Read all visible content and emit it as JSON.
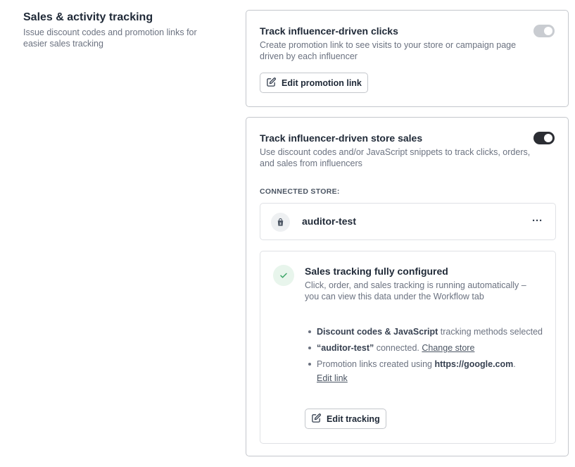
{
  "intro": {
    "title": "Sales & activity tracking",
    "description": "Issue discount codes and promotion links for easier sales tracking"
  },
  "clicks_card": {
    "title": "Track influencer-driven clicks",
    "description": "Create promotion link to see visits to your store or campaign page driven by each influencer",
    "toggle_state": "on-disabled",
    "button_label": "Edit promotion link",
    "button_icon": "edit-icon"
  },
  "sales_card": {
    "title": "Track influencer-driven store sales",
    "description": "Use discount codes and/or JavaScript snippets to track clicks, orders, and sales from influencers",
    "toggle_state": "on",
    "connected_label": "CONNECTED STORE:",
    "store": {
      "icon": "shopify-bag-icon",
      "name": "auditor-test",
      "more_label": "···"
    },
    "status": {
      "icon": "check-icon",
      "title": "Sales tracking fully configured",
      "description": "Click, order, and sales tracking is running automatically – you can view this data under the Workflow tab",
      "bullet1_bold": "Discount codes & JavaScript",
      "bullet1_rest": " tracking methods selected",
      "bullet2_bold": "“auditor-test”",
      "bullet2_rest": " connected. ",
      "bullet2_link": "Change store",
      "bullet3_text": "Promotion links created using ",
      "bullet3_bold": "https://google.com",
      "bullet3_after": ".",
      "bullet3_link": "Edit link",
      "button_label": "Edit tracking",
      "button_icon": "edit-icon"
    }
  },
  "colors": {
    "toggle_on": "#2b2d33",
    "toggle_disabled": "#c9ccd1",
    "check_green": "#3fa66a",
    "check_bg": "#e8f5ec"
  }
}
